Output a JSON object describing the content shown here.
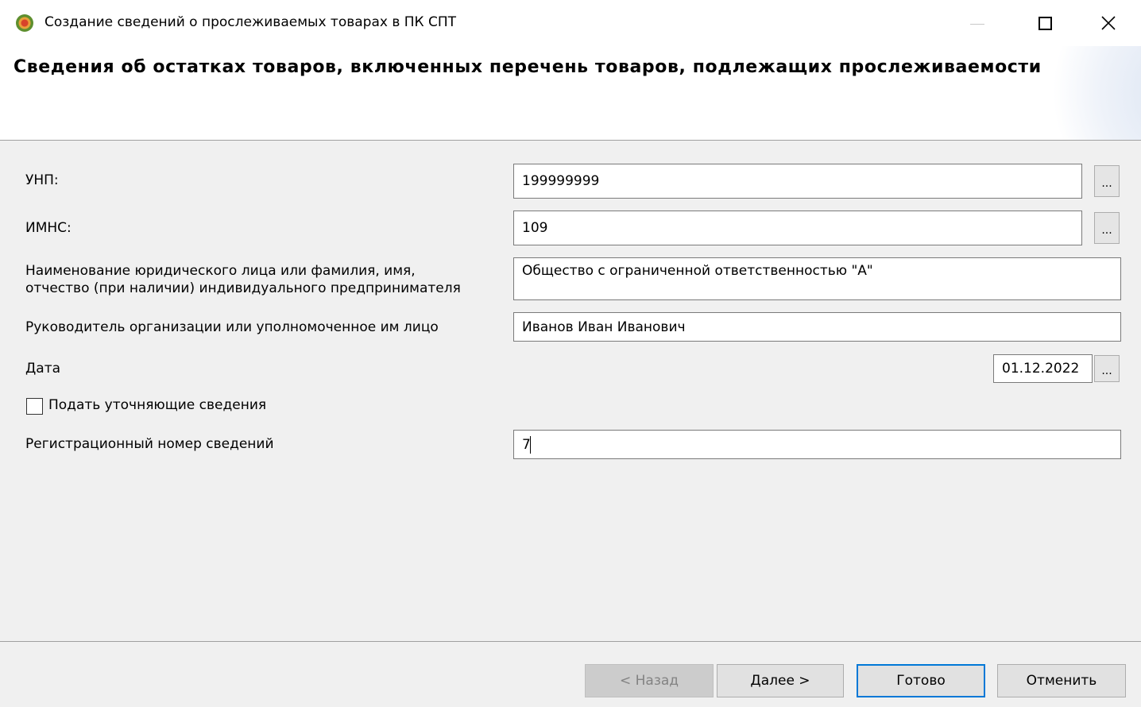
{
  "window": {
    "title": "Создание сведений о прослеживаемых товарах в ПК СПТ",
    "icon": "app-logo-icon"
  },
  "header": {
    "title": "Сведения об остатках товаров, включенных перечень товаров, подлежащих прослеживаемости"
  },
  "form": {
    "unp": {
      "label": "УНП:",
      "value": "199999999",
      "browse": "..."
    },
    "imns": {
      "label": "ИМНС:",
      "value": "109",
      "browse": "..."
    },
    "name": {
      "label_line1": "Наименование  юридического лица или фамилия, имя,",
      "label_line2": "отчество (при наличии) индивидуального предпринимателя",
      "value": "Общество с ограниченной ответственностью  \"А\""
    },
    "head": {
      "label": "Руководитель организации или уполномоченное им лицо",
      "value": "Иванов Иван Иванович"
    },
    "date": {
      "label": "Дата",
      "value": "01.12.2022",
      "browse": "..."
    },
    "clarify": {
      "label": "Подать уточняющие сведения",
      "checked": false
    },
    "reg_number": {
      "label": "Регистрационный номер сведений",
      "value": "7"
    }
  },
  "buttons": {
    "back": "< Назад",
    "next": "Далее >",
    "finish": "Готово",
    "cancel": "Отменить"
  }
}
